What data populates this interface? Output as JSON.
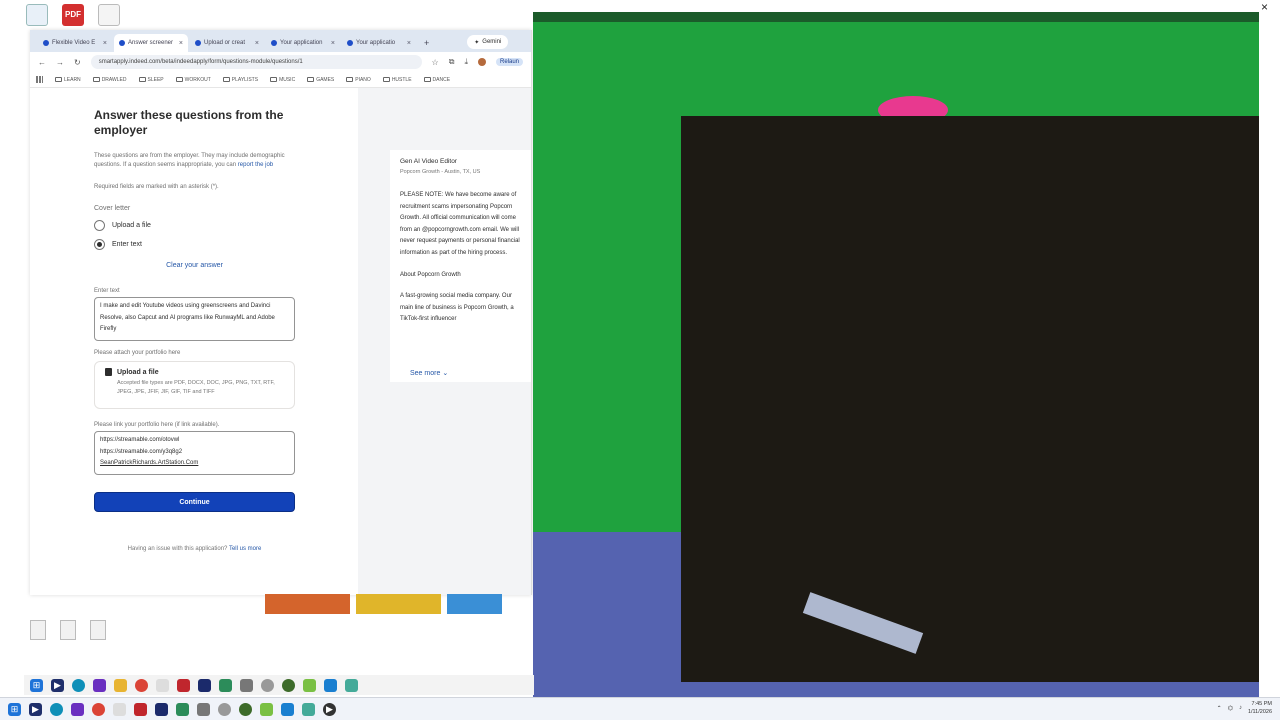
{
  "desktop": {
    "pdf_label": "PDF"
  },
  "browser": {
    "tabs": [
      {
        "label": "Flexible Video E"
      },
      {
        "label": "Answer screener"
      },
      {
        "label": "Upload or creat"
      },
      {
        "label": "Your application"
      },
      {
        "label": "Your applicatio"
      }
    ],
    "new_tab": "+",
    "gemini_label": "Gemini",
    "url": "smartapply.indeed.com/beta/indeedapply/form/questions-module/questions/1",
    "relaunch_label": "Relaun",
    "bookmarks": [
      "LEARN",
      "DRAWLED",
      "SLEEP",
      "WORKOUT",
      "PLAYLISTS",
      "MUSIC",
      "GAMES",
      "PIANO",
      "HUSTLE",
      "DANCE"
    ]
  },
  "form": {
    "title": "Answer these questions from the employer",
    "intro": "These questions are from the employer. They may include demographic questions. If a question seems inappropriate, you can",
    "report_link": "report the job",
    "required_note": "Required fields are marked with an asterisk (*).",
    "cover_letter_label": "Cover letter",
    "option_upload": "Upload a file",
    "option_enter": "Enter text",
    "clear_answer": "Clear your answer",
    "enter_text_label": "Enter text",
    "enter_text_value": "I make and edit Youtube videos using greenscreens and Davinci Resolve, also Capcut and AI programs like RunwayML and Adobe Firefly",
    "portfolio_attach_label": "Please attach your portfolio here",
    "upload_title": "Upload a file",
    "upload_types": "Accepted file types are PDF, DOCX, DOC, JPG, PNG, TXT, RTF, JPEG, JPE, JFIF, JIF, GIF, TIF and TIFF",
    "portfolio_link_label": "Please link your portfolio here (if link available).",
    "links": [
      "https://streamable.com/otovwl",
      "https://streamable.com/y3q8g2",
      "SeanPatrickRichards.ArtStation.Com"
    ],
    "continue_label": "Continue",
    "issue_text": "Having an issue with this application?",
    "issue_link": "Tell us more"
  },
  "job": {
    "title": "Gen AI Video Editor",
    "company": "Popcorn Growth - Austin, TX, US",
    "notice": "PLEASE NOTE: We have become aware of recruitment scams impersonating Popcorn Growth. All official communication will come from an @popcorngrowth.com email. We will never request payments or personal financial information as part of the hiring process.",
    "about_heading": "About Popcorn Growth",
    "about_text": "A fast-growing social media company. Our main line of business is Popcorn Growth, a TikTok-first influencer",
    "see_more": "See more"
  },
  "taskbar": {
    "time": "7:45 PM",
    "date": "1/11/2026"
  },
  "colors": {
    "primary_button": "#1242b8",
    "link": "#2557a7",
    "greenscreen": "#1fa23e"
  }
}
